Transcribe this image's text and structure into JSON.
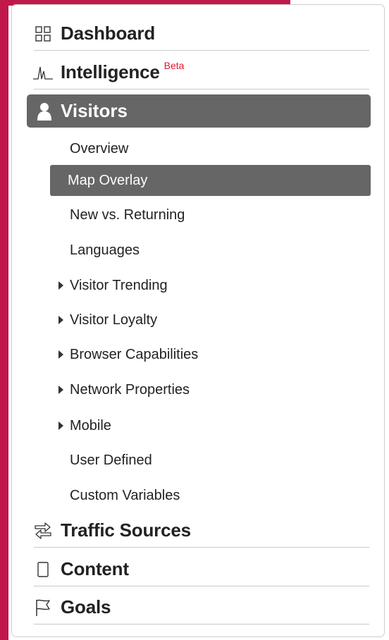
{
  "nav": {
    "dashboard": {
      "label": "Dashboard",
      "icon": "grid-icon"
    },
    "intelligence": {
      "label": "Intelligence",
      "badge": "Beta",
      "icon": "pulse-chart-icon"
    },
    "visitors": {
      "label": "Visitors",
      "icon": "person-icon",
      "items": [
        {
          "label": "Overview",
          "expandable": false
        },
        {
          "label": "Map Overlay",
          "expandable": false,
          "selected": true
        },
        {
          "label": "New vs. Returning",
          "expandable": false
        },
        {
          "label": "Languages",
          "expandable": false
        },
        {
          "label": "Visitor Trending",
          "expandable": true
        },
        {
          "label": "Visitor Loyalty",
          "expandable": true
        },
        {
          "label": "Browser Capabilities",
          "expandable": true
        },
        {
          "label": "Network Properties",
          "expandable": true
        },
        {
          "label": "Mobile",
          "expandable": true
        },
        {
          "label": "User Defined",
          "expandable": false
        },
        {
          "label": "Custom Variables",
          "expandable": false
        }
      ]
    },
    "traffic_sources": {
      "label": "Traffic Sources",
      "icon": "arrows-icon"
    },
    "content": {
      "label": "Content",
      "icon": "page-icon"
    },
    "goals": {
      "label": "Goals",
      "icon": "flag-icon"
    }
  },
  "colors": {
    "page_bg": "#c1184c",
    "active_bg": "#666666",
    "beta": "#e0192f"
  }
}
